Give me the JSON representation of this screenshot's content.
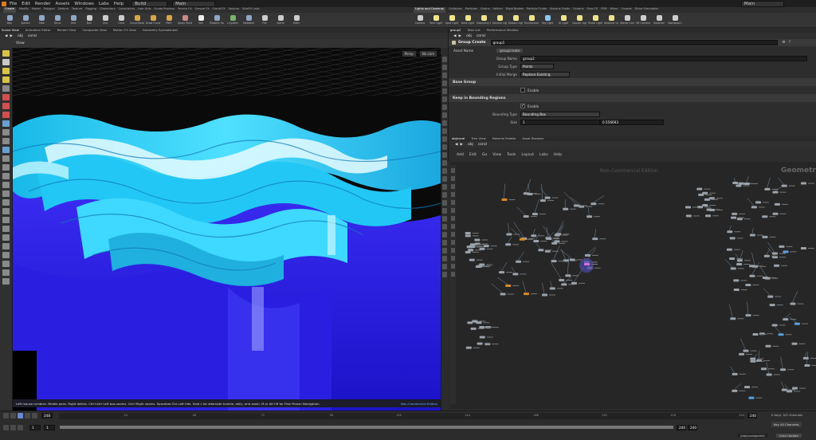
{
  "menu": {
    "items": [
      "File",
      "Edit",
      "Render",
      "Assets",
      "Windows",
      "Labs",
      "Help"
    ],
    "desktop": "Build",
    "context": "Main",
    "right_context": "Main"
  },
  "shelf": {
    "left_tabs": [
      "Create",
      "Modify",
      "Model",
      "Polygon",
      "Deform",
      "Texture",
      "Rigging",
      "Characters",
      "Constraints",
      "Hair Utils",
      "Guide Process",
      "Terrain FX",
      "Simple FX",
      "Cloud FX",
      "Volume",
      "SideFX Labs"
    ],
    "right_tabs": [
      "Lights and Cameras",
      "Collisions",
      "Particles",
      "Grains",
      "Vellum",
      "Rigid Bodies",
      "Particle Fluids",
      "Viscous Fluids",
      "Oceans",
      "Pyro FX",
      "FEM",
      "Wires",
      "Crowds",
      "Drive Simulation"
    ],
    "left_tools": [
      {
        "label": "Box",
        "icon": "box-icon",
        "color": "#8fa7c7"
      },
      {
        "label": "Sphere",
        "icon": "sphere-icon",
        "color": "#8fa7c7"
      },
      {
        "label": "Tube",
        "icon": "tube-icon",
        "color": "#8fa7c7"
      },
      {
        "label": "Torus",
        "icon": "torus-icon",
        "color": "#8fa7c7"
      },
      {
        "label": "Grid",
        "icon": "grid-icon",
        "color": "#8fa7c7"
      },
      {
        "label": "Null",
        "icon": "null-icon",
        "color": "#cccccc"
      },
      {
        "label": "Line",
        "icon": "line-icon",
        "color": "#cccccc"
      },
      {
        "label": "Circle",
        "icon": "circle-icon",
        "color": "#cccccc"
      },
      {
        "label": "Curve Bezier",
        "icon": "curve-bezier-icon",
        "color": "#d9a54a"
      },
      {
        "label": "Draw Curve",
        "icon": "draw-curve-icon",
        "color": "#d9a54a"
      },
      {
        "label": "Path",
        "icon": "path-icon",
        "color": "#d9a54a"
      },
      {
        "label": "Spray Paint",
        "icon": "spray-paint-icon",
        "color": "#c88"
      },
      {
        "label": "Font",
        "icon": "font-icon",
        "color": "#eeeeee"
      },
      {
        "label": "Platonic Solids",
        "icon": "platonic-solids-icon",
        "color": "#8fa7c7"
      },
      {
        "label": "L-System",
        "icon": "l-system-icon",
        "color": "#7ab36b"
      },
      {
        "label": "Metaball",
        "icon": "metaball-icon",
        "color": "#8fa7c7"
      },
      {
        "label": "File",
        "icon": "file-icon",
        "color": "#cccccc"
      },
      {
        "label": "Spiral",
        "icon": "spiral-icon",
        "color": "#cccccc"
      },
      {
        "label": "Helix",
        "icon": "helix-icon",
        "color": "#cccccc"
      }
    ],
    "right_tools": [
      {
        "label": "Camera",
        "icon": "camera-icon",
        "color": "#cccccc"
      },
      {
        "label": "Point Light",
        "icon": "point-light-icon",
        "color": "#f0e28a"
      },
      {
        "label": "Spot Light",
        "icon": "spot-light-icon",
        "color": "#f0e28a"
      },
      {
        "label": "Area Light",
        "icon": "area-light-icon",
        "color": "#f0e28a"
      },
      {
        "label": "Geometry Light",
        "icon": "geometry-light-icon",
        "color": "#f0e28a"
      },
      {
        "label": "Volume Light",
        "icon": "volume-light-icon",
        "color": "#f0e28a"
      },
      {
        "label": "Distant Light",
        "icon": "distant-light-icon",
        "color": "#f0e28a"
      },
      {
        "label": "Environment Light",
        "icon": "environment-light-icon",
        "color": "#f0e28a"
      },
      {
        "label": "Sky Light",
        "icon": "sky-light-icon",
        "color": "#8ac7f0"
      },
      {
        "label": "GI Light",
        "icon": "gi-light-icon",
        "color": "#f0e28a"
      },
      {
        "label": "Caustic Light",
        "icon": "caustic-light-icon",
        "color": "#f0e28a"
      },
      {
        "label": "Portal Light",
        "icon": "portal-light-icon",
        "color": "#f0e28a"
      },
      {
        "label": "Ambient Light",
        "icon": "ambient-light-icon",
        "color": "#f0e28a"
      },
      {
        "label": "Stereo Camera",
        "icon": "stereo-camera-icon",
        "color": "#cccccc"
      },
      {
        "label": "VR Camera",
        "icon": "vr-camera-icon",
        "color": "#cccccc"
      },
      {
        "label": "Switcher",
        "icon": "switcher-icon",
        "color": "#cccccc"
      },
      {
        "label": "Gamepad Camera",
        "icon": "gamepad-camera-icon",
        "color": "#cccccc"
      }
    ]
  },
  "left_pane": {
    "tabs": [
      "Scene View",
      "Animation Editor",
      "Render View",
      "Composite View",
      "Motion FX View",
      "Geometry Spreadsheet"
    ],
    "path": [
      "obj",
      "coral"
    ],
    "view_label": "View",
    "persp_label": "Persp",
    "cam_label": "No cam",
    "status_text": "Left mouse tumbles. Middle pans. Right dollies. Ctrl+Alt+Left box-zooms. Ctrl+Right zooms. Spacebar-Ctrl-Left tilts. Hold L for alternate tumble, dolly, and zoom.    M or Alt+M for First Person Navigation.",
    "watermark": "Non-Commercial Edition"
  },
  "params_pane": {
    "tabs": [
      "group2",
      "Take List",
      "Performance Monitor"
    ],
    "path": [
      "obj",
      "coral"
    ],
    "node_type": "Group Create",
    "node_name": "group1",
    "asset_name_label": "Asset Name",
    "asset_name_value": "groupcreate",
    "group_name_label": "Group Name",
    "group_name_value": "group2",
    "group_type_label": "Group Type",
    "group_type_value": "Points",
    "initial_merge_label": "Initial Merge",
    "initial_merge_value": "Replace Existing",
    "base_group_section": "Base Group",
    "enable_label": "Enable",
    "bounding_section": "Keep in Bounding Regions",
    "bounding_enable_label": "Enable",
    "bounding_type_label": "Bounding Type",
    "bounding_type_value": "Bounding Box",
    "size_label": "Size",
    "size_value": "1",
    "size_value2": "0.556693"
  },
  "network_pane": {
    "tabs": [
      "obj/coral",
      "Tree View",
      "Material Palette",
      "Asset Browser"
    ],
    "path": [
      "obj",
      "coral"
    ],
    "menu": [
      "Add",
      "Edit",
      "Go",
      "View",
      "Tools",
      "Layout",
      "Labs",
      "Help"
    ],
    "watermark": "Non-Commercial Edition",
    "context_label": "Geometry"
  },
  "timeline": {
    "current_frame": "248",
    "start_frame": "1",
    "start_frame2": "1",
    "end_frame": "240",
    "end_frame2": "240",
    "ticks": [
      "24",
      "48",
      "72",
      "96",
      "120",
      "144",
      "168",
      "192",
      "216",
      "240"
    ],
    "keys_info": "0 keys, 0/0 channels",
    "key_all_label": "Key All Channels",
    "path_label": "/obj/coral/paint1",
    "auto_update_label": "Auto Update",
    "progress": 1.0
  },
  "colors": {
    "deep_blue": "#2a1fe0",
    "cyan": "#27d3ff",
    "light_cyan": "#aef4ff",
    "node_gray": "#9aa2aa",
    "node_orange": "#d8892a",
    "accent_yellow": "#e2c430"
  }
}
